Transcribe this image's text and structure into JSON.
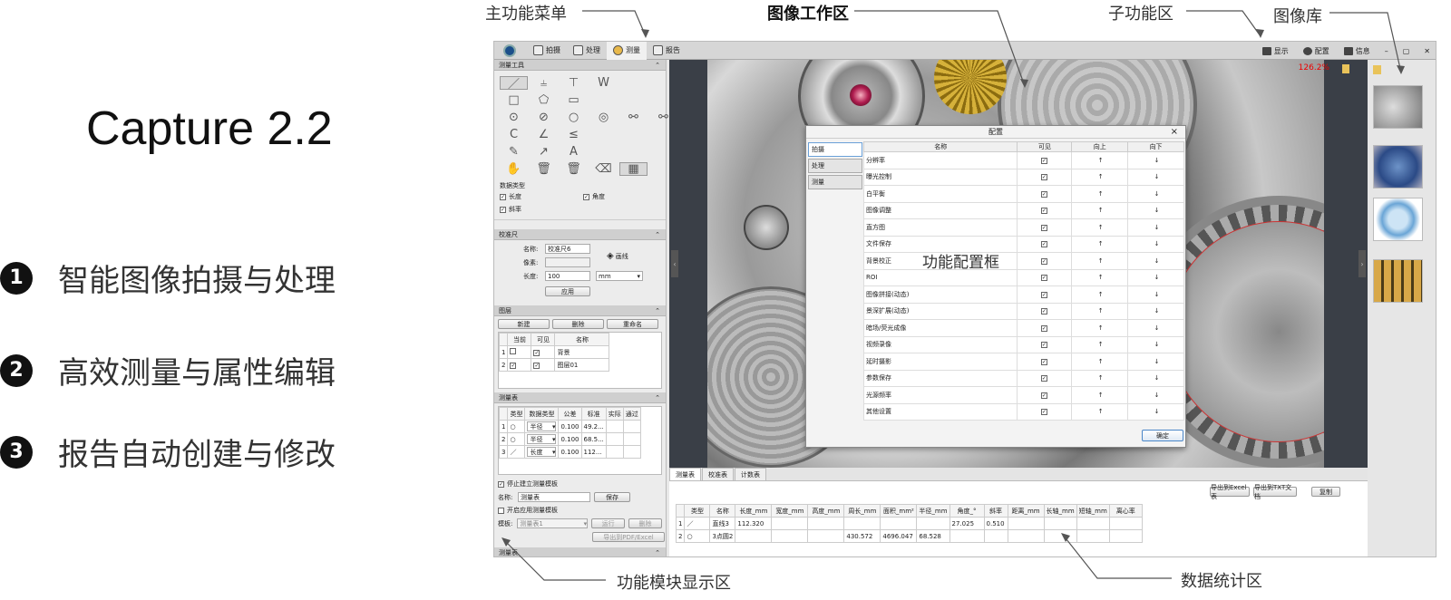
{
  "brand": {
    "title": "Capture 2.2",
    "features": [
      {
        "num": "1",
        "text": "智能图像拍摄与处理"
      },
      {
        "num": "2",
        "text": "高效测量与属性编辑"
      },
      {
        "num": "3",
        "text": "报告自动创建与修改"
      }
    ]
  },
  "callouts": {
    "main_menu": "主功能菜单",
    "workspace": "图像工作区",
    "sub_menu": "子功能区",
    "gallery": "图像库",
    "module_area": "功能模块显示区",
    "stats_area": "数据统计区",
    "dialog_label": "功能配置框"
  },
  "menubar": {
    "tabs": [
      "拍摄",
      "处理",
      "测量",
      "报告"
    ],
    "active_tab": "测量",
    "right": [
      "显示",
      "配置",
      "信息"
    ],
    "win_controls": [
      "–",
      "▢",
      "✕"
    ]
  },
  "left_panel": {
    "measure_tools": {
      "header": "测量工具",
      "data_type_label": "数据类型",
      "data_types": [
        {
          "label": "长度",
          "checked": true
        },
        {
          "label": "角度",
          "checked": true
        },
        {
          "label": "斜率",
          "checked": true
        }
      ]
    },
    "calibration": {
      "header": "校准尺",
      "name_label": "名称:",
      "name_value": "校准尺6",
      "pixel_label": "像素:",
      "pixel_value": "",
      "length_label": "长度:",
      "length_value": "100",
      "unit": "mm",
      "draw_label": "画线",
      "apply": "应用"
    },
    "layers": {
      "header": "图层",
      "buttons": [
        "新建",
        "删除",
        "重命名"
      ],
      "columns": [
        "当前",
        "可见",
        "名称"
      ],
      "rows": [
        {
          "idx": "1",
          "current": false,
          "visible": true,
          "name": "背景"
        },
        {
          "idx": "2",
          "current": true,
          "visible": true,
          "name": "图层01"
        }
      ]
    },
    "measure_tpl": {
      "header": "测量表",
      "columns": [
        "类型",
        "数据类型",
        "公差",
        "标准",
        "实际",
        "通过"
      ],
      "rows": [
        {
          "idx": "1",
          "type": "○",
          "dtype": "半径",
          "tol": "0.100",
          "std": "49.2..."
        },
        {
          "idx": "2",
          "type": "○",
          "dtype": "半径",
          "tol": "0.100",
          "std": "68.5..."
        },
        {
          "idx": "3",
          "type": "／",
          "dtype": "长度",
          "tol": "0.100",
          "std": "112..."
        }
      ],
      "stop_label": "停止建立测量模板",
      "name_label": "名称:",
      "name_value": "测量表",
      "save": "保存",
      "enable_label": "开启应用测量模板",
      "template_label": "模板:",
      "template_value": "测量表1",
      "run": "运行",
      "delete": "删除",
      "export": "导出到PDF/Excel",
      "next_header": "测量表"
    }
  },
  "workspace": {
    "zoom": "126.2%"
  },
  "dialog": {
    "title": "配置",
    "close": "×",
    "side": [
      "拍摄",
      "处理",
      "测量"
    ],
    "active_side": "拍摄",
    "columns": [
      "名称",
      "可见",
      "向上",
      "向下"
    ],
    "rows": [
      "分辨率",
      "曝光控制",
      "白平衡",
      "图像调整",
      "直方图",
      "文件保存",
      "背景校正",
      "ROI",
      "图像拼接(动态)",
      "景深扩展(动态)",
      "暗场/荧光成像",
      "视频录像",
      "延时摄影",
      "参数保存",
      "光源频率",
      "其他设置"
    ],
    "up": "↑",
    "down": "↓",
    "ok": "确定"
  },
  "stats": {
    "tabs": [
      "测量表",
      "校准表",
      "计数表"
    ],
    "buttons": [
      "导出到Excel表",
      "导出到TXT文档",
      "复制"
    ],
    "columns": [
      "类型",
      "名称",
      "长度_mm",
      "宽度_mm",
      "高度_mm",
      "周长_mm",
      "面积_mm²",
      "半径_mm",
      "角度_°",
      "斜率",
      "距离_mm",
      "长轴_mm",
      "短轴_mm",
      "离心率"
    ],
    "rows": [
      {
        "idx": "1",
        "type": "／",
        "name": "直线3",
        "len": "112.320",
        "w": "",
        "h": "",
        "per": "",
        "area": "",
        "r": "",
        "ang": "27.025",
        "slope": "0.510"
      },
      {
        "idx": "2",
        "type": "○",
        "name": "3点圆2",
        "len": "",
        "w": "",
        "h": "",
        "per": "430.572",
        "area": "4696.047",
        "r": "68.528",
        "ang": "",
        "slope": ""
      }
    ]
  }
}
